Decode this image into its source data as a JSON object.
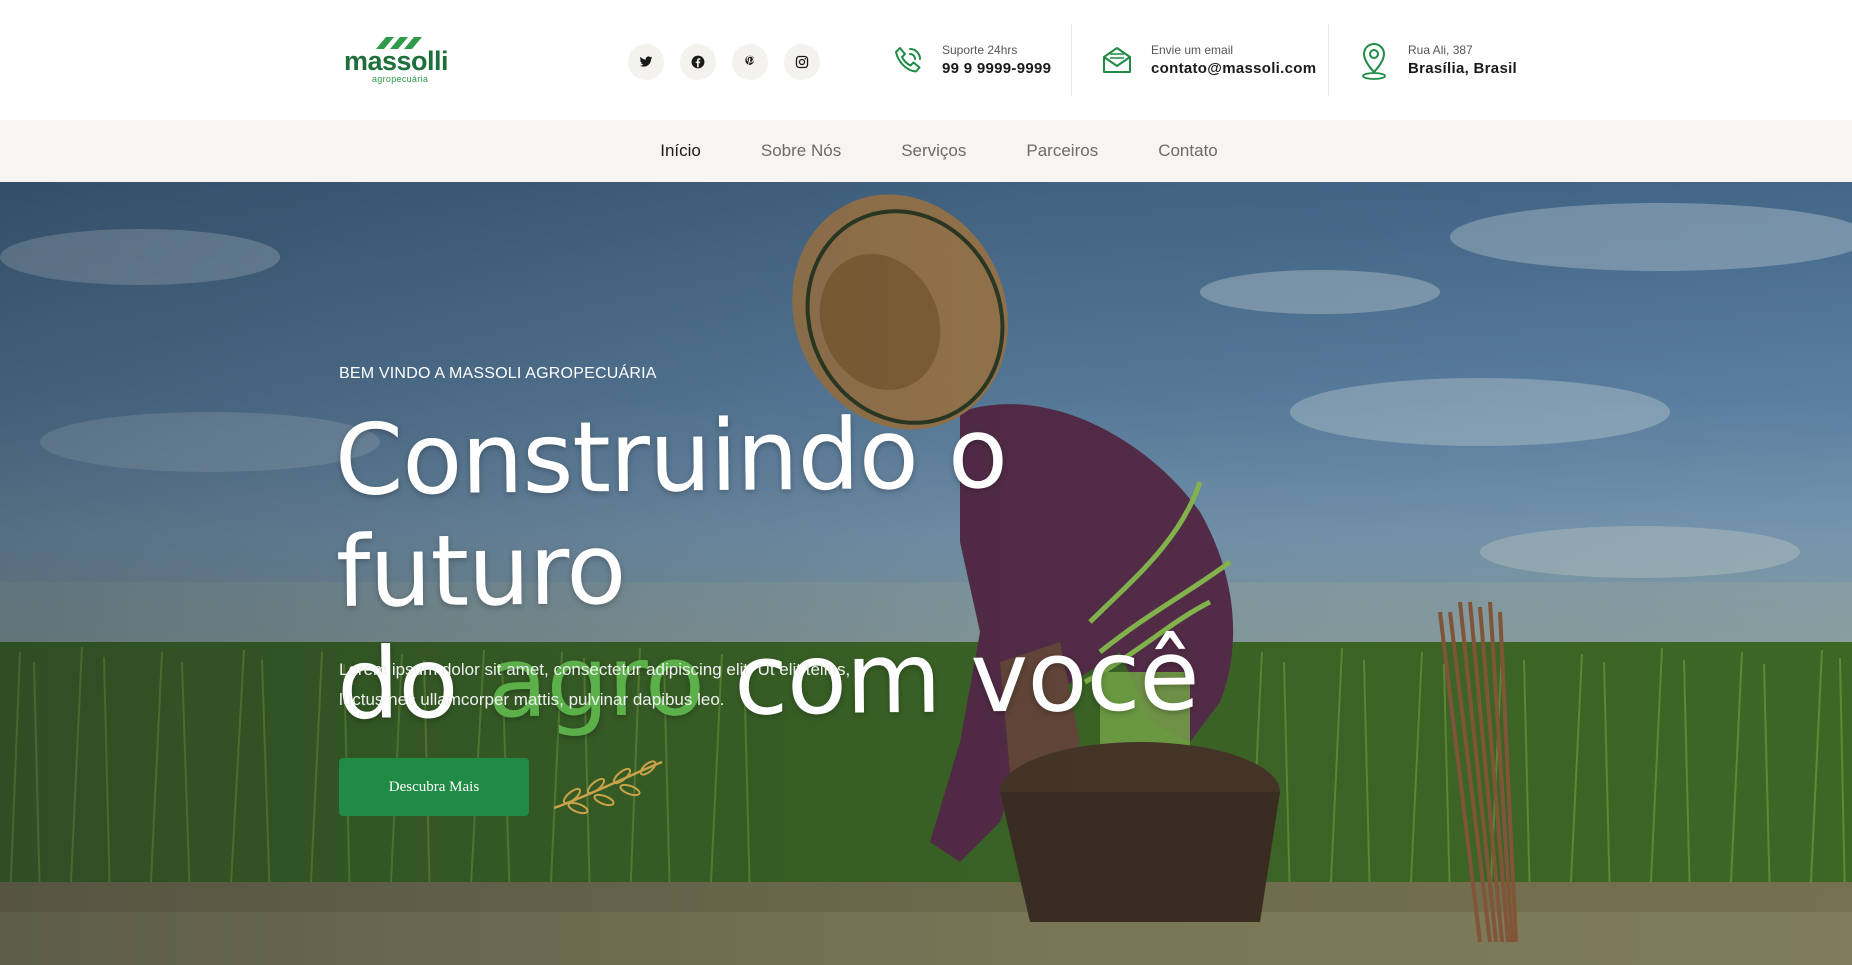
{
  "brand": {
    "name": "massolli",
    "tagline": "agropecuária",
    "color_primary": "#1e6f3a",
    "color_accent": "#5bb04a"
  },
  "socials": [
    {
      "icon": "twitter-icon"
    },
    {
      "icon": "facebook-icon"
    },
    {
      "icon": "pinterest-icon"
    },
    {
      "icon": "instagram-icon"
    }
  ],
  "contacts": {
    "phone": {
      "icon": "phone-icon",
      "label": "Suporte 24hrs",
      "value": "99 9 9999-9999"
    },
    "email": {
      "icon": "mail-icon",
      "label": "Envie um email",
      "value": "contato@massoli.com"
    },
    "address": {
      "icon": "location-pin-icon",
      "label": "Rua Ali, 387",
      "value": "Brasília, Brasil"
    }
  },
  "nav": {
    "items": [
      {
        "label": "Início",
        "active": true
      },
      {
        "label": "Sobre Nós",
        "active": false
      },
      {
        "label": "Serviços",
        "active": false
      },
      {
        "label": "Parceiros",
        "active": false
      },
      {
        "label": "Contato",
        "active": false
      }
    ]
  },
  "hero": {
    "eyebrow": "BEM VINDO A MASSOLI AGROPECUÁRIA",
    "headline_line1": "Construindo o futuro",
    "headline_pre": "do ",
    "headline_highlight": "agro",
    "headline_post": " com você",
    "lead": "Lorem ipsum dolor sit amet, consectetur adipiscing elit. Ut elit tellus, luctus nec ullamcorper mattis, pulvinar dapibus leo.",
    "cta_label": "Descubra Mais",
    "cta_color": "#1f8b45",
    "decor_icon": "wheat-branch-icon"
  }
}
